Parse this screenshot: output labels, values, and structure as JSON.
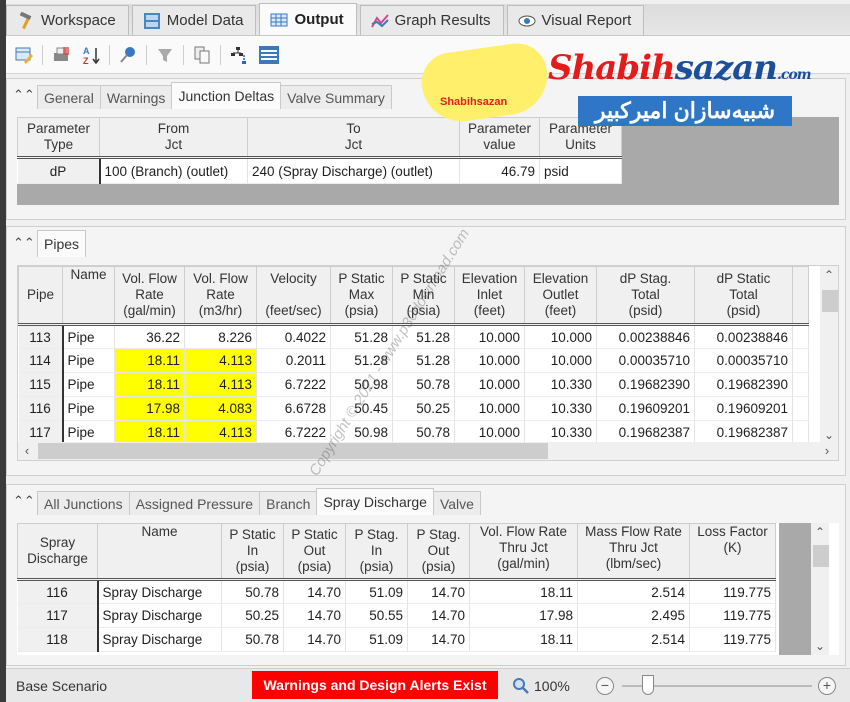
{
  "top_tabs": [
    {
      "label": "Workspace",
      "icon": "hammer-icon"
    },
    {
      "label": "Model Data",
      "icon": "model-data-icon"
    },
    {
      "label": "Output",
      "icon": "table-grid-icon",
      "active": true
    },
    {
      "label": "Graph Results",
      "icon": "graph-icon"
    },
    {
      "label": "Visual Report",
      "icon": "eye-icon"
    }
  ],
  "toolbar": {
    "buttons": [
      "edit-output-icon",
      "print-icon",
      "sort-az-icon",
      "pin-icon",
      "filter-icon",
      "copy-icon",
      "hierarchy-icon",
      "list-lines-icon"
    ]
  },
  "general_section": {
    "tabs": [
      "General",
      "Warnings",
      "Junction Deltas",
      "Valve Summary"
    ],
    "active_tab": "Junction Deltas",
    "columns": [
      [
        "Parameter",
        "Type"
      ],
      [
        "From",
        "Jct"
      ],
      [
        "To",
        "Jct"
      ],
      [
        "Parameter",
        "value"
      ],
      [
        "Parameter",
        "Units"
      ]
    ],
    "rows": [
      {
        "type": "dP",
        "from": "100 (Branch)  (outlet)",
        "to": "240 (Spray Discharge)  (outlet)",
        "value": "46.79",
        "units": "psid"
      }
    ]
  },
  "pipes_section": {
    "tabs": [
      "Pipes"
    ],
    "active_tab": "Pipes",
    "columns": [
      [
        "Pipe"
      ],
      [
        "Name"
      ],
      [
        "Vol. Flow",
        "Rate",
        "(gal/min)"
      ],
      [
        "Vol. Flow",
        "Rate",
        "(m3/hr)"
      ],
      [
        "Velocity",
        "",
        "(feet/sec)"
      ],
      [
        "P Static",
        "Max",
        "(psia)"
      ],
      [
        "P Static",
        "Min",
        "(psia)"
      ],
      [
        "Elevation",
        "Inlet",
        "(feet)"
      ],
      [
        "Elevation",
        "Outlet",
        "(feet)"
      ],
      [
        "dP Stag.",
        "Total",
        "(psid)"
      ],
      [
        "dP Static",
        "Total",
        "(psid)"
      ]
    ],
    "rows": [
      {
        "pipe": "113",
        "name": "Pipe",
        "vfr_gpm": "36.22",
        "vfr_m3hr": "8.226",
        "velocity": "0.4022",
        "ps_max": "51.28",
        "ps_min": "51.28",
        "elev_in": "10.000",
        "elev_out": "10.000",
        "dp_stag": "0.00238846",
        "dp_static": "0.00238846",
        "highlight": false
      },
      {
        "pipe": "114",
        "name": "Pipe",
        "vfr_gpm": "18.11",
        "vfr_m3hr": "4.113",
        "velocity": "0.2011",
        "ps_max": "51.28",
        "ps_min": "51.28",
        "elev_in": "10.000",
        "elev_out": "10.000",
        "dp_stag": "0.00035710",
        "dp_static": "0.00035710",
        "highlight": true
      },
      {
        "pipe": "115",
        "name": "Pipe",
        "vfr_gpm": "18.11",
        "vfr_m3hr": "4.113",
        "velocity": "6.7222",
        "ps_max": "50.98",
        "ps_min": "50.78",
        "elev_in": "10.000",
        "elev_out": "10.330",
        "dp_stag": "0.19682390",
        "dp_static": "0.19682390",
        "highlight": true
      },
      {
        "pipe": "116",
        "name": "Pipe",
        "vfr_gpm": "17.98",
        "vfr_m3hr": "4.083",
        "velocity": "6.6728",
        "ps_max": "50.45",
        "ps_min": "50.25",
        "elev_in": "10.000",
        "elev_out": "10.330",
        "dp_stag": "0.19609201",
        "dp_static": "0.19609201",
        "highlight": true
      },
      {
        "pipe": "117",
        "name": "Pipe",
        "vfr_gpm": "18.11",
        "vfr_m3hr": "4.113",
        "velocity": "6.7222",
        "ps_max": "50.98",
        "ps_min": "50.78",
        "elev_in": "10.000",
        "elev_out": "10.330",
        "dp_stag": "0.19682387",
        "dp_static": "0.19682387",
        "highlight": true
      }
    ],
    "highlight_color": "#ffff00"
  },
  "junctions_section": {
    "tabs": [
      "All Junctions",
      "Assigned Pressure",
      "Branch",
      "Spray Discharge",
      "Valve"
    ],
    "active_tab": "Spray Discharge",
    "columns": [
      [
        "Spray",
        "Discharge"
      ],
      [
        "Name"
      ],
      [
        "P Static",
        "In",
        "(psia)"
      ],
      [
        "P Static",
        "Out",
        "(psia)"
      ],
      [
        "P Stag.",
        "In",
        "(psia)"
      ],
      [
        "P Stag.",
        "Out",
        "(psia)"
      ],
      [
        "Vol. Flow Rate",
        "Thru Jct",
        "(gal/min)"
      ],
      [
        "Mass Flow Rate",
        "Thru Jct",
        "(lbm/sec)"
      ],
      [
        "Loss Factor",
        "(K)"
      ]
    ],
    "rows": [
      {
        "id": "116",
        "name": "Spray Discharge",
        "ps_in": "50.78",
        "ps_out": "14.70",
        "pst_in": "51.09",
        "pst_out": "14.70",
        "vfr": "18.11",
        "mfr": "2.514",
        "k": "119.775"
      },
      {
        "id": "117",
        "name": "Spray Discharge",
        "ps_in": "50.25",
        "ps_out": "14.70",
        "pst_in": "50.55",
        "pst_out": "14.70",
        "vfr": "17.98",
        "mfr": "2.495",
        "k": "119.775"
      },
      {
        "id": "118",
        "name": "Spray Discharge",
        "ps_in": "50.78",
        "ps_out": "14.70",
        "pst_in": "51.09",
        "pst_out": "14.70",
        "vfr": "18.11",
        "mfr": "2.514",
        "k": "119.775"
      }
    ]
  },
  "status": {
    "scenario": "Base Scenario",
    "alert": "Warnings and Design Alerts Exist",
    "alert_color": "#ff0000",
    "zoom": "100%",
    "zoom_out": "−",
    "zoom_in": "+"
  },
  "watermark": {
    "brand_red": "Shabih",
    "brand_blue": "sazan",
    "brand_tld": ".com",
    "persian": "شبیه‌سازان امیرکبیر",
    "badge_text": "Shabihsazan",
    "copyright": "Copyright © 2021 - www.p30download.com"
  }
}
